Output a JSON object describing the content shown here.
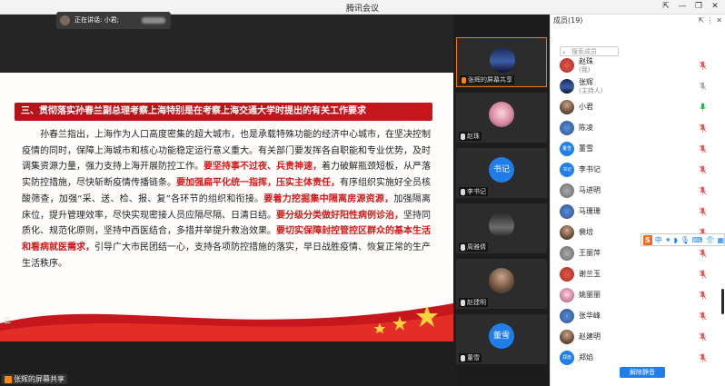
{
  "window": {
    "title": "腾讯会议",
    "controls": [
      "⇱",
      "—",
      "❐",
      "✕"
    ]
  },
  "share": {
    "heading": "三、贯彻落实孙春兰副总理考察上海特别是在考察上海交通大学时提出的有关工作要求",
    "body": [
      {
        "t": "孙春兰指出，上海作为人口高度密集的超大城市，也是承载特殊功能的经济中心城市，在坚决控制疫情的同时，保障上海城市和核心功能稳定运行意义重大。有关部门要发挥各自职能和专业优势，及时调集资源力量，强力支持上海开展防控工作。",
        "red": false
      },
      {
        "t": "要坚持事不过夜、兵贵神速，",
        "red": true
      },
      {
        "t": "着力破解瓶颈短板，从严落实防控措施，尽快斩断疫情传播链条。",
        "red": false
      },
      {
        "t": "要加强扁平化统一指挥，压实主体责任，",
        "red": true
      },
      {
        "t": "有序组织实施好全员核酸筛查，加强“采、送、检、报、复”各环节的组织和衔接。",
        "red": false
      },
      {
        "t": "要着力挖掘集中隔离房源资源，",
        "red": true
      },
      {
        "t": "加强隔离床位，提升管理效率，尽快实现密接人员应隔尽隔、日清日结。",
        "red": false
      },
      {
        "t": "要分级分类做好阳性病例诊治，",
        "red": true
      },
      {
        "t": "坚持同质化、规范化原则，坚持中西医结合，多措并举提升救治效果。",
        "red": false
      },
      {
        "t": "要切实保障封控管控区群众的基本生活和看病就医需求，",
        "red": true
      },
      {
        "t": "引导广大市民团结一心，支持各项防控措施的落实，早日战胜疫情、恢复正常的生产生活秩序。",
        "red": false
      }
    ],
    "label": "张辉的屏幕共享"
  },
  "videos": [
    {
      "name": "张辉的屏幕共享",
      "avatar": "",
      "kind": "img-sky",
      "active": true
    },
    {
      "name": "赵珠",
      "avatar": "",
      "kind": "img-cake",
      "active": false
    },
    {
      "name": "李书记",
      "avatar": "书记",
      "kind": "text",
      "active": false
    },
    {
      "name": "周雅倩",
      "avatar": "",
      "kind": "img-dark",
      "active": false
    },
    {
      "name": "赵建明",
      "avatar": "",
      "kind": "img-person",
      "active": false
    },
    {
      "name": "董雪",
      "avatar": "董雪",
      "kind": "text",
      "active": false
    }
  ],
  "panel": {
    "title": "成员(19)",
    "header_icons": "⇱ ⋮ ✕",
    "speaking": "正在讲话: 小君;",
    "search_placeholder": "搜索成员",
    "unmute_label": "解除静音",
    "members": [
      {
        "name": "赵珠",
        "sub": "(我)",
        "avatar": "",
        "kind": "img-red",
        "mic": "off"
      },
      {
        "name": "张辉",
        "sub": "(主持人)",
        "avatar": "",
        "kind": "img-sky",
        "mic": "mute-gray"
      },
      {
        "name": "小君",
        "sub": "",
        "avatar": "",
        "kind": "img-person",
        "mic": "on"
      },
      {
        "name": "陈凌",
        "sub": "",
        "avatar": "",
        "kind": "img-blue",
        "mic": "off"
      },
      {
        "name": "董雪",
        "sub": "",
        "avatar": "董雪",
        "kind": "text",
        "mic": "off"
      },
      {
        "name": "李书记",
        "sub": "",
        "avatar": "书记",
        "kind": "text",
        "mic": "off"
      },
      {
        "name": "马进明",
        "sub": "",
        "avatar": "",
        "kind": "img-gray",
        "mic": "off"
      },
      {
        "name": "马珊珊",
        "sub": "",
        "avatar": "",
        "kind": "img-blue",
        "mic": "off"
      },
      {
        "name": "裴培",
        "sub": "",
        "avatar": "",
        "kind": "img-person",
        "mic": "off"
      },
      {
        "name": "王丽萍",
        "sub": "",
        "avatar": "",
        "kind": "img-gray",
        "mic": "off"
      },
      {
        "name": "谢兰玉",
        "sub": "",
        "avatar": "",
        "kind": "img-red",
        "mic": "off"
      },
      {
        "name": "姚丽丽",
        "sub": "",
        "avatar": "",
        "kind": "img-cake",
        "mic": "off"
      },
      {
        "name": "张华峰",
        "sub": "",
        "avatar": "",
        "kind": "img-blue",
        "mic": "off"
      },
      {
        "name": "赵建明",
        "sub": "",
        "avatar": "",
        "kind": "img-person",
        "mic": "off"
      },
      {
        "name": "郑焰",
        "sub": "",
        "avatar": "郑焰",
        "kind": "text",
        "mic": "off"
      }
    ]
  },
  "ime": {
    "logo": "S",
    "items": [
      "中",
      "⁕",
      "◗",
      "🎙",
      "⌨",
      "👕",
      "▦"
    ]
  },
  "colors": {
    "accent": "#1f7ee8",
    "slide_red": "#c8161d",
    "mic_off": "#e05a5a",
    "mic_on": "#2bb24c"
  }
}
